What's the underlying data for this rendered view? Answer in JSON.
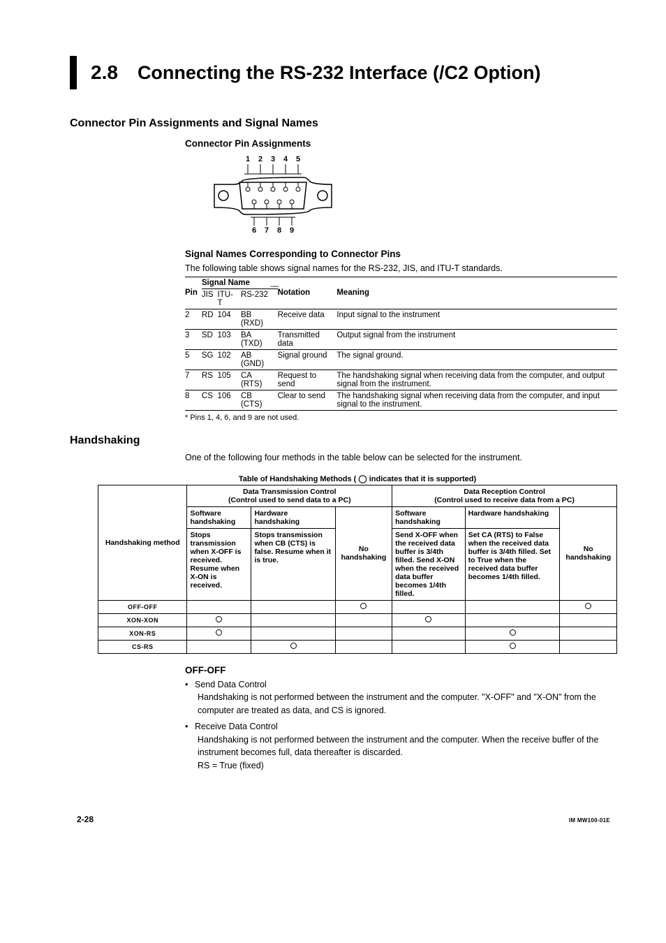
{
  "header": {
    "sectionNumber": "2.8",
    "sectionTitle": "Connecting the RS-232 Interface (/C2 Option)"
  },
  "h3_1": "Connector Pin Assignments and Signal Names",
  "h4_1": "Connector Pin Assignments",
  "diagram": {
    "topLabels": [
      "1",
      "2",
      "3",
      "4",
      "5"
    ],
    "botLabels": [
      "6",
      "7",
      "8",
      "9"
    ]
  },
  "h4_2": "Signal Names Corresponding to Connector Pins",
  "sigIntro": "The following table shows signal names for the RS-232, JIS, and ITU-T standards.",
  "sigHead": {
    "pin": "Pin",
    "signalName": "Signal Name",
    "jis": "JIS",
    "itu": "ITU-T",
    "rs": "RS-232",
    "notation": "Notation",
    "meaning": "Meaning"
  },
  "sigRows": [
    {
      "pin": "2",
      "jis": "RD",
      "itu": "104",
      "rs": "BB (RXD)",
      "notation": "Receive data",
      "meaning": "Input signal to the instrument"
    },
    {
      "pin": "3",
      "jis": "SD",
      "itu": "103",
      "rs": "BA (TXD)",
      "notation": "Transmitted data",
      "meaning": "Output signal from the instrument"
    },
    {
      "pin": "5",
      "jis": "SG",
      "itu": "102",
      "rs": "AB (GND)",
      "notation": "Signal ground",
      "meaning": "The signal ground."
    },
    {
      "pin": "7",
      "jis": "RS",
      "itu": "105",
      "rs": "CA (RTS)",
      "notation": "Request to send",
      "meaning": "The handshaking signal when receiving data from the computer, and output signal from the instrument."
    },
    {
      "pin": "8",
      "jis": "CS",
      "itu": "106",
      "rs": "CB (CTS)",
      "notation": "Clear to send",
      "meaning": "The handshaking signal when receiving data from the computer, and input signal to the instrument."
    }
  ],
  "sigFootnote": "*  Pins 1, 4, 6, and 9 are not used.",
  "h3_2": "Handshaking",
  "hsIntro": "One of the following four methods in the table below can be selected for the instrument.",
  "hsCaption": "Table of Handshaking Methods ( ◯ indicates that it is supported)",
  "hsHead": {
    "method": "Handshaking method",
    "txControl": "Data Transmission Control",
    "txControlSub": "(Control used to send data to a PC)",
    "rxControl": "Data Reception Control",
    "rxControlSub": "(Control used to receive data from a PC)",
    "swHs": "Software handshaking",
    "hwHs": "Hardware handshaking",
    "noHs": "No handshaking",
    "txSw": "Stops transmission when X-OFF is received. Resume when X-ON is received.",
    "txHw": "Stops transmission when CB (CTS) is false. Resume when it is true.",
    "rxSw": "Send X-OFF when the received data buffer is 3/4th filled. Send X-ON when the received data buffer becomes 1/4th filled.",
    "rxHw": "Set CA (RTS) to False when the received data buffer is 3/4th filled. Set to True when the received data buffer becomes 1/4th filled."
  },
  "hsMethods": {
    "offoff": "OFF-OFF",
    "xonxon": "XON-XON",
    "xonrs": "XON-RS",
    "csrs": "CS-RS"
  },
  "offoff": {
    "title": "OFF-OFF",
    "b1": "Send Data Control",
    "b1t": "Handshaking is not performed between the instrument and the computer. \"X-OFF\" and \"X-ON\" from the computer are treated as data, and CS is ignored.",
    "b2": "Receive Data Control",
    "b2t": "Handshaking is not performed between the instrument and the computer. When the receive buffer of the instrument becomes full, data thereafter is discarded.",
    "rs": "RS = True (fixed)"
  },
  "footer": {
    "page": "2-28",
    "docid": "IM MW100-01E"
  }
}
